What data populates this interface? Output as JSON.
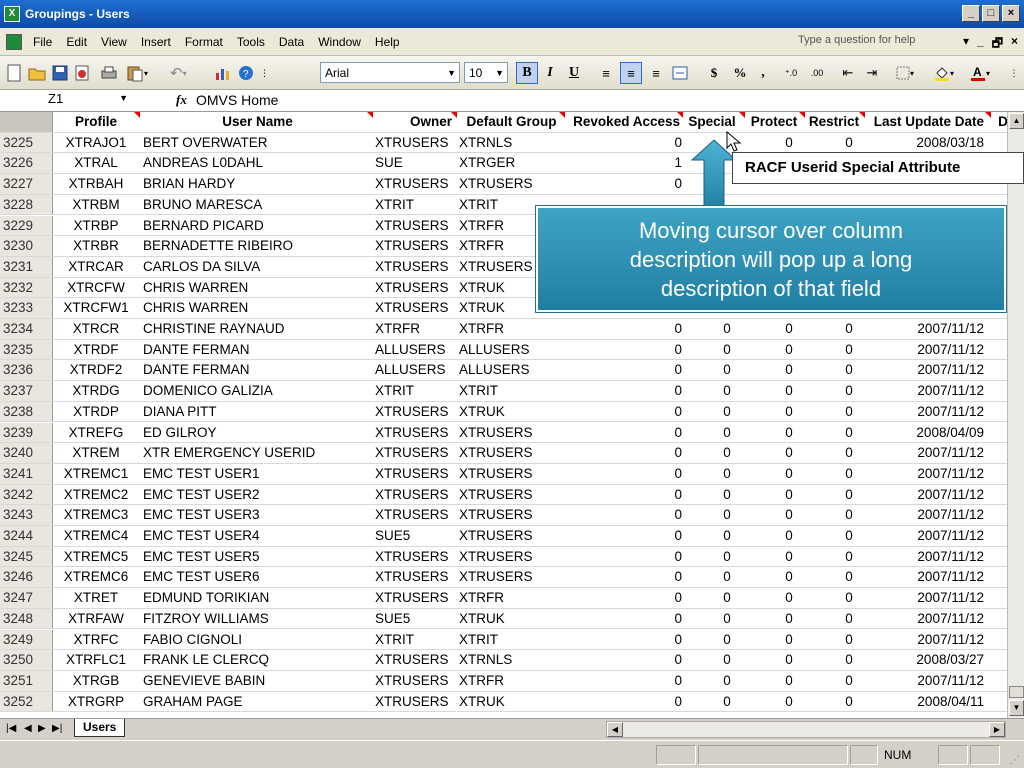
{
  "window": {
    "title": "Groupings - Users",
    "app_icon": "X"
  },
  "menu": {
    "items": [
      "File",
      "Edit",
      "View",
      "Insert",
      "Format",
      "Tools",
      "Data",
      "Window",
      "Help"
    ],
    "help_placeholder": "Type a question for help"
  },
  "toolbar": {
    "font_name": "Arial",
    "font_size": "10",
    "bold": "B",
    "italic": "I",
    "underline": "U",
    "currency": "$",
    "percent": "%",
    "comma": ","
  },
  "formula_bar": {
    "name_box": "Z1",
    "fx": "fx",
    "formula": "OMVS Home"
  },
  "sheet": {
    "headers": {
      "profile": "Profile",
      "user_name": "User Name",
      "owner": "Owner",
      "default_group": "Default Group",
      "revoked": "Revoked Access",
      "special": "Special",
      "protect": "Protect",
      "restrict": "Restrict",
      "last_update": "Last Update Date",
      "more": "D"
    },
    "rows": [
      {
        "n": "3225",
        "profile": "XTRAJO1",
        "name": "BERT OVERWATER",
        "owner": "XTRUSERS",
        "group": "XTRNLS",
        "rev": "0",
        "spec": "",
        "prot": "0",
        "rest": "0",
        "date": "2008/03/18"
      },
      {
        "n": "3226",
        "profile": "XTRAL",
        "name": "ANDREAS L0DAHL",
        "owner": "SUE",
        "group": "XTRGER",
        "rev": "1",
        "spec": "",
        "prot": "",
        "rest": "",
        "date": ""
      },
      {
        "n": "3227",
        "profile": "XTRBAH",
        "name": "BRIAN HARDY",
        "owner": "XTRUSERS",
        "group": "XTRUSERS",
        "rev": "0",
        "spec": "",
        "prot": "",
        "rest": "",
        "date": ""
      },
      {
        "n": "3228",
        "profile": "XTRBM",
        "name": "BRUNO MARESCA",
        "owner": "XTRIT",
        "group": "XTRIT",
        "rev": "",
        "spec": "",
        "prot": "",
        "rest": "",
        "date": ""
      },
      {
        "n": "3229",
        "profile": "XTRBP",
        "name": "BERNARD PICARD",
        "owner": "XTRUSERS",
        "group": "XTRFR",
        "rev": "",
        "spec": "",
        "prot": "",
        "rest": "",
        "date": ""
      },
      {
        "n": "3230",
        "profile": "XTRBR",
        "name": "BERNADETTE RIBEIRO",
        "owner": "XTRUSERS",
        "group": "XTRFR",
        "rev": "",
        "spec": "",
        "prot": "",
        "rest": "",
        "date": ""
      },
      {
        "n": "3231",
        "profile": "XTRCAR",
        "name": "CARLOS DA SILVA",
        "owner": "XTRUSERS",
        "group": "XTRUSERS",
        "rev": "",
        "spec": "",
        "prot": "",
        "rest": "",
        "date": ""
      },
      {
        "n": "3232",
        "profile": "XTRCFW",
        "name": "CHRIS WARREN",
        "owner": "XTRUSERS",
        "group": "XTRUK",
        "rev": "",
        "spec": "",
        "prot": "",
        "rest": "",
        "date": ""
      },
      {
        "n": "3233",
        "profile": "XTRCFW1",
        "name": "CHRIS WARREN",
        "owner": "XTRUSERS",
        "group": "XTRUK",
        "rev": "",
        "spec": "",
        "prot": "",
        "rest": "",
        "date": ""
      },
      {
        "n": "3234",
        "profile": "XTRCR",
        "name": "CHRISTINE RAYNAUD",
        "owner": "XTRFR",
        "group": "XTRFR",
        "rev": "0",
        "spec": "0",
        "prot": "0",
        "rest": "0",
        "date": "2007/11/12"
      },
      {
        "n": "3235",
        "profile": "XTRDF",
        "name": "DANTE FERMAN",
        "owner": "ALLUSERS",
        "group": "ALLUSERS",
        "rev": "0",
        "spec": "0",
        "prot": "0",
        "rest": "0",
        "date": "2007/11/12"
      },
      {
        "n": "3236",
        "profile": "XTRDF2",
        "name": "DANTE FERMAN",
        "owner": "ALLUSERS",
        "group": "ALLUSERS",
        "rev": "0",
        "spec": "0",
        "prot": "0",
        "rest": "0",
        "date": "2007/11/12"
      },
      {
        "n": "3237",
        "profile": "XTRDG",
        "name": "DOMENICO GALIZIA",
        "owner": "XTRIT",
        "group": "XTRIT",
        "rev": "0",
        "spec": "0",
        "prot": "0",
        "rest": "0",
        "date": "2007/11/12"
      },
      {
        "n": "3238",
        "profile": "XTRDP",
        "name": "DIANA PITT",
        "owner": "XTRUSERS",
        "group": "XTRUK",
        "rev": "0",
        "spec": "0",
        "prot": "0",
        "rest": "0",
        "date": "2007/11/12"
      },
      {
        "n": "3239",
        "profile": "XTREFG",
        "name": "ED GILROY",
        "owner": "XTRUSERS",
        "group": "XTRUSERS",
        "rev": "0",
        "spec": "0",
        "prot": "0",
        "rest": "0",
        "date": "2008/04/09"
      },
      {
        "n": "3240",
        "profile": "XTREM",
        "name": "XTR EMERGENCY USERID",
        "owner": "XTRUSERS",
        "group": "XTRUSERS",
        "rev": "0",
        "spec": "0",
        "prot": "0",
        "rest": "0",
        "date": "2007/11/12"
      },
      {
        "n": "3241",
        "profile": "XTREMC1",
        "name": "EMC TEST USER1",
        "owner": "XTRUSERS",
        "group": "XTRUSERS",
        "rev": "0",
        "spec": "0",
        "prot": "0",
        "rest": "0",
        "date": "2007/11/12"
      },
      {
        "n": "3242",
        "profile": "XTREMC2",
        "name": "EMC TEST USER2",
        "owner": "XTRUSERS",
        "group": "XTRUSERS",
        "rev": "0",
        "spec": "0",
        "prot": "0",
        "rest": "0",
        "date": "2007/11/12"
      },
      {
        "n": "3243",
        "profile": "XTREMC3",
        "name": "EMC TEST USER3",
        "owner": "XTRUSERS",
        "group": "XTRUSERS",
        "rev": "0",
        "spec": "0",
        "prot": "0",
        "rest": "0",
        "date": "2007/11/12"
      },
      {
        "n": "3244",
        "profile": "XTREMC4",
        "name": "EMC TEST USER4",
        "owner": "SUE5",
        "group": "XTRUSERS",
        "rev": "0",
        "spec": "0",
        "prot": "0",
        "rest": "0",
        "date": "2007/11/12"
      },
      {
        "n": "3245",
        "profile": "XTREMC5",
        "name": "EMC TEST USER5",
        "owner": "XTRUSERS",
        "group": "XTRUSERS",
        "rev": "0",
        "spec": "0",
        "prot": "0",
        "rest": "0",
        "date": "2007/11/12"
      },
      {
        "n": "3246",
        "profile": "XTREMC6",
        "name": "EMC TEST USER6",
        "owner": "XTRUSERS",
        "group": "XTRUSERS",
        "rev": "0",
        "spec": "0",
        "prot": "0",
        "rest": "0",
        "date": "2007/11/12"
      },
      {
        "n": "3247",
        "profile": "XTRET",
        "name": "EDMUND TORIKIAN",
        "owner": "XTRUSERS",
        "group": "XTRFR",
        "rev": "0",
        "spec": "0",
        "prot": "0",
        "rest": "0",
        "date": "2007/11/12"
      },
      {
        "n": "3248",
        "profile": "XTRFAW",
        "name": "FITZROY WILLIAMS",
        "owner": "SUE5",
        "group": "XTRUK",
        "rev": "0",
        "spec": "0",
        "prot": "0",
        "rest": "0",
        "date": "2007/11/12"
      },
      {
        "n": "3249",
        "profile": "XTRFC",
        "name": "FABIO CIGNOLI",
        "owner": "XTRIT",
        "group": "XTRIT",
        "rev": "0",
        "spec": "0",
        "prot": "0",
        "rest": "0",
        "date": "2007/11/12"
      },
      {
        "n": "3250",
        "profile": "XTRFLC1",
        "name": "FRANK LE CLERCQ",
        "owner": "XTRUSERS",
        "group": "XTRNLS",
        "rev": "0",
        "spec": "0",
        "prot": "0",
        "rest": "0",
        "date": "2008/03/27"
      },
      {
        "n": "3251",
        "profile": "XTRGB",
        "name": "GENEVIEVE BABIN",
        "owner": "XTRUSERS",
        "group": "XTRFR",
        "rev": "0",
        "spec": "0",
        "prot": "0",
        "rest": "0",
        "date": "2007/11/12"
      },
      {
        "n": "3252",
        "profile": "XTRGRP",
        "name": "GRAHAM PAGE",
        "owner": "XTRUSERS",
        "group": "XTRUK",
        "rev": "0",
        "spec": "0",
        "prot": "0",
        "rest": "0",
        "date": "2008/04/11"
      }
    ],
    "tab": "Users"
  },
  "annotations": {
    "tooltip": "RACF Userid Special Attribute",
    "callout": [
      "Moving cursor over column",
      "description will pop up a long",
      "description of that field"
    ]
  },
  "status": {
    "num": "NUM"
  },
  "colors": {
    "title": "#0b4ba8",
    "callout": "#2a8fb5",
    "comment_marker": "#e00000"
  }
}
